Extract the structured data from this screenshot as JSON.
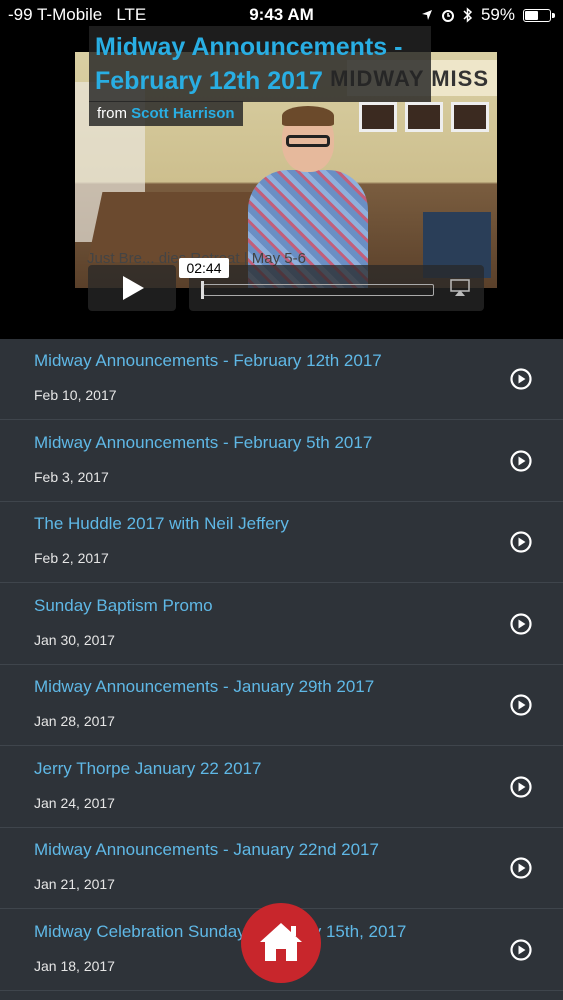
{
  "status_bar": {
    "carrier": "-99 T-Mobile",
    "network": "LTE",
    "time": "9:43 AM",
    "battery": "59%",
    "battery_level": 0.59
  },
  "video": {
    "title": "Midway Announcements - February 12th 2017",
    "from_label": "from",
    "author": "Scott Harrison",
    "sign_text": "MIDWAY MISS",
    "banner_text": "Just Bre... dies Retreat | May 5-6",
    "elapsed": "02:44",
    "progress": 0.0
  },
  "icons": {
    "play": "play-icon",
    "airplay": "airplay-icon",
    "play_circle": "play-circle-icon",
    "home": "home-icon"
  },
  "colors": {
    "accent": "#5fb8e6",
    "title_blue": "#29aee3",
    "list_bg": "#2e3339",
    "home_red": "#c8262c"
  },
  "items": [
    {
      "title": "Midway Announcements - February 12th 2017",
      "date": "Feb 10, 2017"
    },
    {
      "title": "Midway Announcements - February 5th 2017",
      "date": "Feb 3, 2017"
    },
    {
      "title": "The Huddle 2017 with Neil Jeffery",
      "date": "Feb 2, 2017"
    },
    {
      "title": "Sunday Baptism Promo",
      "date": "Jan 30, 2017"
    },
    {
      "title": "Midway Announcements - January 29th 2017",
      "date": "Jan 28, 2017"
    },
    {
      "title": "Jerry Thorpe January 22 2017",
      "date": "Jan 24, 2017"
    },
    {
      "title": "Midway Announcements - January 22nd 2017",
      "date": "Jan 21, 2017"
    },
    {
      "title": "Midway Celebration Sunday - January 15th, 2017",
      "date": "Jan 18, 2017"
    }
  ]
}
